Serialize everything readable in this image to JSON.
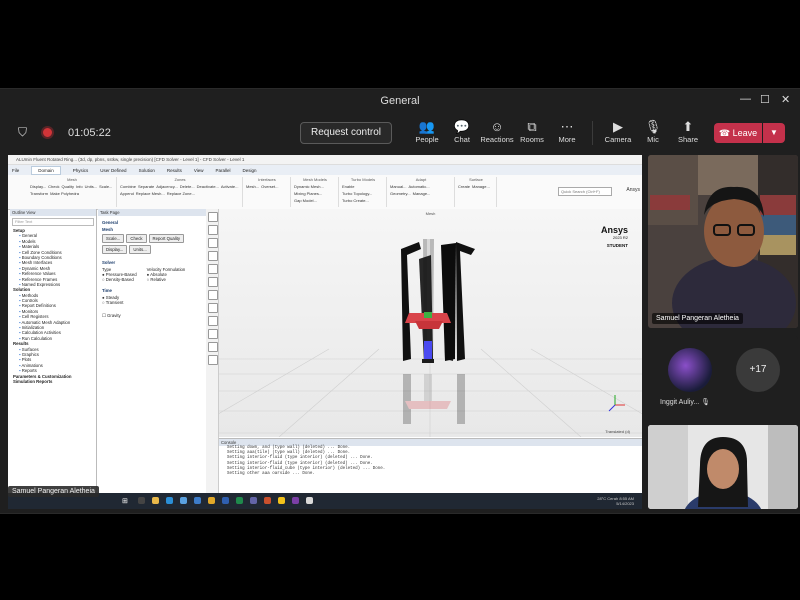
{
  "window": {
    "title": "General"
  },
  "toolbar": {
    "timer": "01:05:22",
    "request_control": "Request control",
    "people": "People",
    "chat": "Chat",
    "reactions": "Reactions",
    "rooms": "Rooms",
    "more": "More",
    "camera": "Camera",
    "mic": "Mic",
    "share": "Share",
    "leave": "Leave"
  },
  "ansys": {
    "title_bar": "ALUmin Fluent Rotated Ring...  (3d, dp, pbns, sstkw, single precision) [CFD Solver - Level 1] - CFD Solver - Level 1",
    "menu_tabs": [
      "File",
      "Domain",
      "Physics",
      "User Defined",
      "Solution",
      "Results",
      "View",
      "Parallel",
      "Design"
    ],
    "search_placeholder": "Quick Search (Ctrl+F)",
    "brand_tab": "Ansys",
    "ribbon_groups": [
      {
        "title": "Mesh",
        "items": [
          "Display...",
          "Check",
          "Quality",
          "Info",
          "Units...",
          "Scale...",
          "Transform",
          "Make Polyhedra"
        ]
      },
      {
        "title": "Zones",
        "items": [
          "Combine",
          "Separate",
          "Adjacency...",
          "Delete...",
          "Deactivate...",
          "Activate...",
          "Append",
          "Replace Mesh...",
          "Replace Zone..."
        ]
      },
      {
        "title": "Interfaces",
        "items": [
          "Mesh...",
          "Overset..."
        ]
      },
      {
        "title": "Mesh Models",
        "items": [
          "Dynamic Mesh...",
          "Mixing Planes...",
          "Gap Model..."
        ]
      },
      {
        "title": "Turbo Models",
        "items": [
          "Enable",
          "Turbo Topology...",
          "Turbo Create..."
        ]
      },
      {
        "title": "Adapt",
        "items": [
          "Manual...",
          "Automatic...",
          "Geometry...",
          "Manage..."
        ]
      },
      {
        "title": "Surface",
        "items": [
          "Create",
          "Manage..."
        ]
      }
    ],
    "outline": {
      "header": "Outline View",
      "filter": "Filter Text",
      "items": [
        {
          "text": "Setup",
          "level": 1
        },
        {
          "text": "General",
          "level": 2
        },
        {
          "text": "Models",
          "level": 2
        },
        {
          "text": "Materials",
          "level": 2
        },
        {
          "text": "Cell Zone Conditions",
          "level": 2
        },
        {
          "text": "Boundary Conditions",
          "level": 2
        },
        {
          "text": "Mesh Interfaces",
          "level": 2
        },
        {
          "text": "Dynamic Mesh",
          "level": 2
        },
        {
          "text": "Reference Values",
          "level": 2
        },
        {
          "text": "Reference Frames",
          "level": 2
        },
        {
          "text": "Named Expressions",
          "level": 2
        },
        {
          "text": "Solution",
          "level": 1
        },
        {
          "text": "Methods",
          "level": 2
        },
        {
          "text": "Controls",
          "level": 2
        },
        {
          "text": "Report Definitions",
          "level": 2
        },
        {
          "text": "Monitors",
          "level": 2
        },
        {
          "text": "Cell Registers",
          "level": 2
        },
        {
          "text": "Automatic Mesh Adaption",
          "level": 2
        },
        {
          "text": "Initialization",
          "level": 2
        },
        {
          "text": "Calculation Activities",
          "level": 2
        },
        {
          "text": "Run Calculation",
          "level": 2
        },
        {
          "text": "Results",
          "level": 1
        },
        {
          "text": "Surfaces",
          "level": 2
        },
        {
          "text": "Graphics",
          "level": 2
        },
        {
          "text": "Plots",
          "level": 2
        },
        {
          "text": "Animations",
          "level": 2
        },
        {
          "text": "Reports",
          "level": 2
        },
        {
          "text": "Parameters & Customization",
          "level": 1
        },
        {
          "text": "Simulation Reports",
          "level": 1
        }
      ]
    },
    "task_page": {
      "header": "Task Page",
      "section": "General",
      "mesh_label": "Mesh",
      "mesh_buttons": [
        "Scale...",
        "Check",
        "Report Quality",
        "Display...",
        "Units..."
      ],
      "solver_label": "Solver",
      "type_label": "Type",
      "type_options": [
        "Pressure-Based",
        "Density-Based"
      ],
      "velocity_label": "Velocity Formulation",
      "velocity_options": [
        "Absolute",
        "Relative"
      ],
      "time_label": "Time",
      "time_options": [
        "Steady",
        "Transient"
      ],
      "gravity": "Gravity"
    },
    "viewport": {
      "title": "Mesh",
      "logo": "Ansys",
      "version": "2023 R2",
      "edition": "STUDENT",
      "footer": "Translated  (d)"
    },
    "console": {
      "header": "Console",
      "lines": [
        "Setting down, and (type wall) (deleted) ... Done.",
        "Setting aaa(tile) (type wall) (deleted) ... Done.",
        "Setting interior-fluid (type interior) (deleted) ... Done.",
        "Setting interior-fluid (type interior) (deleted) ... Done.",
        "Setting interior-fluid_cube (type interior) (deleted) ... Done.",
        "Setting other aaa oarside ... Done."
      ]
    },
    "taskbar": {
      "weather": "28°C  Cerah",
      "time": "8:55 AM",
      "date": "5/14/2023"
    }
  },
  "sharer_name": "Samuel Pangeran Aletheia",
  "participants": [
    {
      "name": "Samuel Pangeran Aletheia"
    },
    {
      "name": "Inggit Auliy..."
    }
  ],
  "overflow_count": "+17",
  "colors": {
    "leave": "#c4314b",
    "record": "#d13438",
    "teams_bg": "#1f1f1f"
  }
}
